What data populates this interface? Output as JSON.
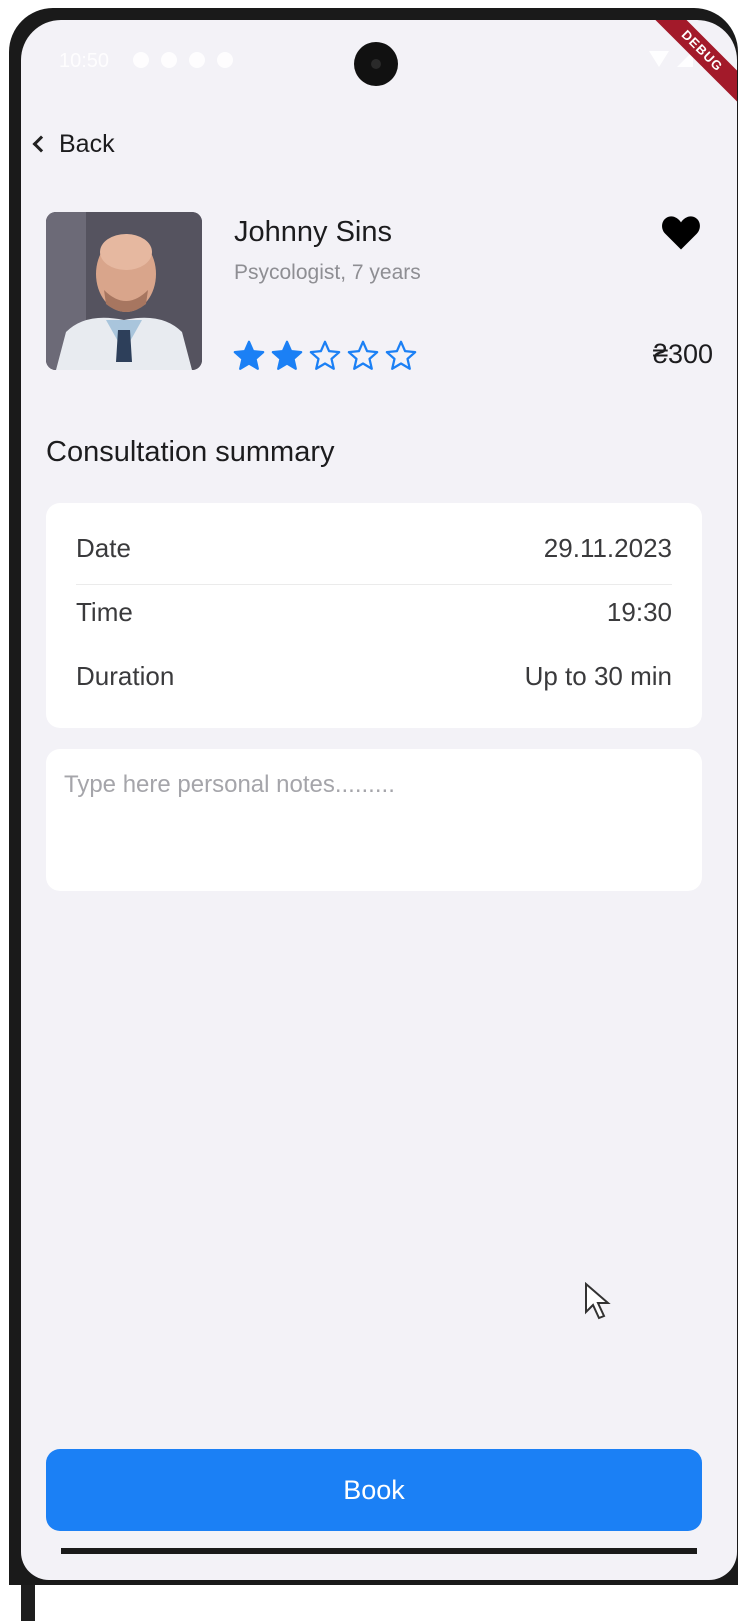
{
  "status_bar": {
    "time": "10:50"
  },
  "debug_banner": "DEBUG",
  "nav": {
    "back_label": "Back"
  },
  "doctor": {
    "name": "Johnny Sins",
    "subtitle": "Psycologist, 7 years",
    "rating": 2,
    "rating_max": 5,
    "price": "₴300",
    "favorite": true
  },
  "summary": {
    "title": "Consultation summary",
    "rows": [
      {
        "label": "Date",
        "value": "29.11.2023"
      },
      {
        "label": "Time",
        "value": "19:30"
      },
      {
        "label": "Duration",
        "value": "Up to 30 min"
      }
    ]
  },
  "notes": {
    "placeholder": "Type here personal notes.........",
    "value": ""
  },
  "actions": {
    "book_label": "Book"
  },
  "colors": {
    "accent": "#1b80f5",
    "background": "#f3f2f7",
    "star": "#1b80f5",
    "debug": "#a31a2a"
  }
}
